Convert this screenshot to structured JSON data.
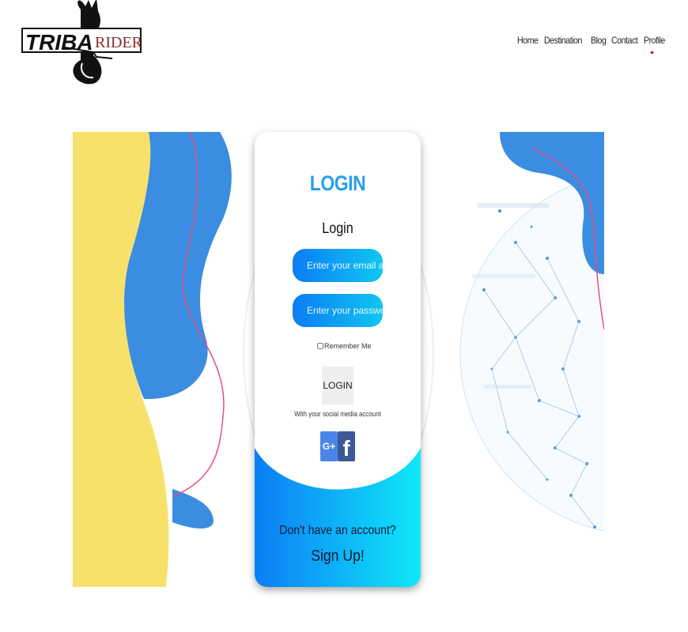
{
  "brand": {
    "name_part1": "TRIBA",
    "name_part2": "RIDER"
  },
  "nav": {
    "items": [
      "Home",
      "Destination",
      "Blog",
      "Contact",
      "Profile"
    ],
    "active": "Profile"
  },
  "login_card": {
    "title": "LOGIN",
    "subtitle": "Login",
    "email_placeholder": "Enter your email addres",
    "password_placeholder": "Enter your password",
    "remember_label": "Remember Me",
    "login_button": "LOGIN",
    "social_text": "With your social media account",
    "google_label": "G+",
    "facebook_label": "f",
    "signup_prompt": "Don't have an account?",
    "signup_link": "Sign Up!"
  },
  "colors": {
    "accent_blue": "#27a0ea",
    "gradient_start": "#0b7df5",
    "gradient_end": "#10c6f2",
    "nav_marker": "#b3202a"
  }
}
